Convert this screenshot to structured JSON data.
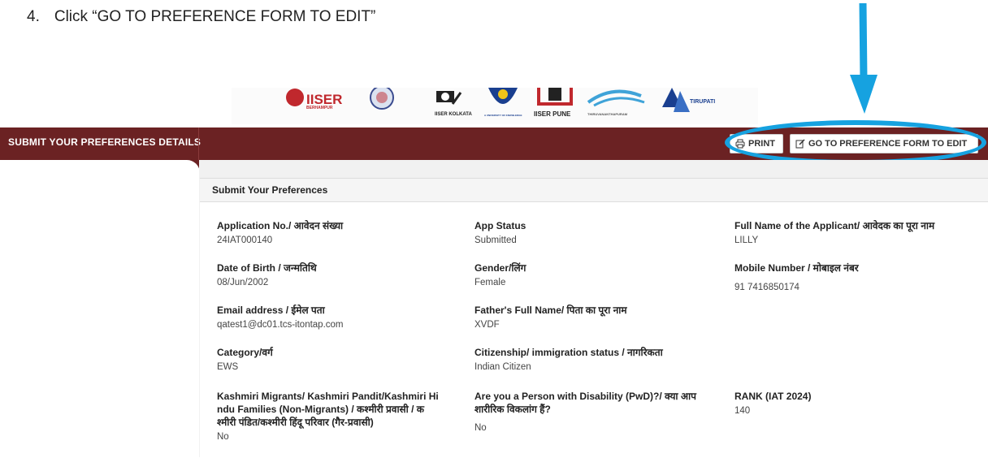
{
  "instruction": {
    "number": "4.",
    "text": "Click “GO TO PREFERENCE FORM TO EDIT”"
  },
  "logos": {
    "berhampur_text": "BERHAMPUR",
    "kolkata_text": "IISER KOLKATA",
    "mohali_text": "A UNIVERSITY OF KNOWLEDGE",
    "pune_text": "IISER PUNE",
    "tvm_text": "THIRUVANANTHAPURAM",
    "tirupati_text": "TIRUPATI"
  },
  "sidebar": {
    "title": "SUBMIT YOUR PREFERENCES DETAILS"
  },
  "toolbar": {
    "print_label": "PRINT",
    "edit_label": "GO TO PREFERENCE FORM TO EDIT"
  },
  "card": {
    "title": "Submit Your Preferences"
  },
  "fields": {
    "application_no": {
      "label": "Application No./ आवेदन संख्या",
      "value": "24IAT000140"
    },
    "app_status": {
      "label": "App Status",
      "value": "Submitted"
    },
    "full_name": {
      "label": "Full Name of the Applicant/ आवेदक का पूरा नाम",
      "value": "LILLY"
    },
    "dob": {
      "label": "Date of Birth / जन्मतिथि",
      "value": "08/Jun/2002"
    },
    "gender": {
      "label": "Gender/लिंग",
      "value": "Female"
    },
    "mobile": {
      "label": "Mobile Number / मोबाइल नंबर",
      "value": "91 7416850174"
    },
    "email": {
      "label": "Email address / ईमेल पता",
      "value": "qatest1@dc01.tcs-itontap.com"
    },
    "father": {
      "label": "Father's Full Name/ पिता का पूरा नाम",
      "value": "XVDF"
    },
    "category": {
      "label": "Category/वर्ग",
      "value": "EWS"
    },
    "citizenship": {
      "label": "Citizenship/ immigration status / नागरिकता",
      "value": "Indian Citizen"
    },
    "kashmiri": {
      "label_line1": "Kashmiri Migrants/ Kashmiri Pandit/Kashmiri Hi",
      "label_line2": "ndu Families (Non-Migrants) / कश्मीरी प्रवासी / क",
      "label_line3": "श्मीरी पंडित/कश्मीरी हिंदू परिवार (गैर-प्रवासी)",
      "value": "No"
    },
    "pwd": {
      "label_line1": "Are you a Person with Disability (PwD)?/ क्या आप",
      "label_line2": "शारीरिक विकलांग हैं?",
      "value": "No"
    },
    "rank": {
      "label": "RANK (IAT 2024)",
      "value": "140"
    }
  },
  "colors": {
    "header_bar": "#6b2223",
    "callout": "#16a2e0"
  },
  "icons": {
    "print": "printer-icon",
    "edit": "edit-icon",
    "arrow": "down-arrow-icon"
  }
}
